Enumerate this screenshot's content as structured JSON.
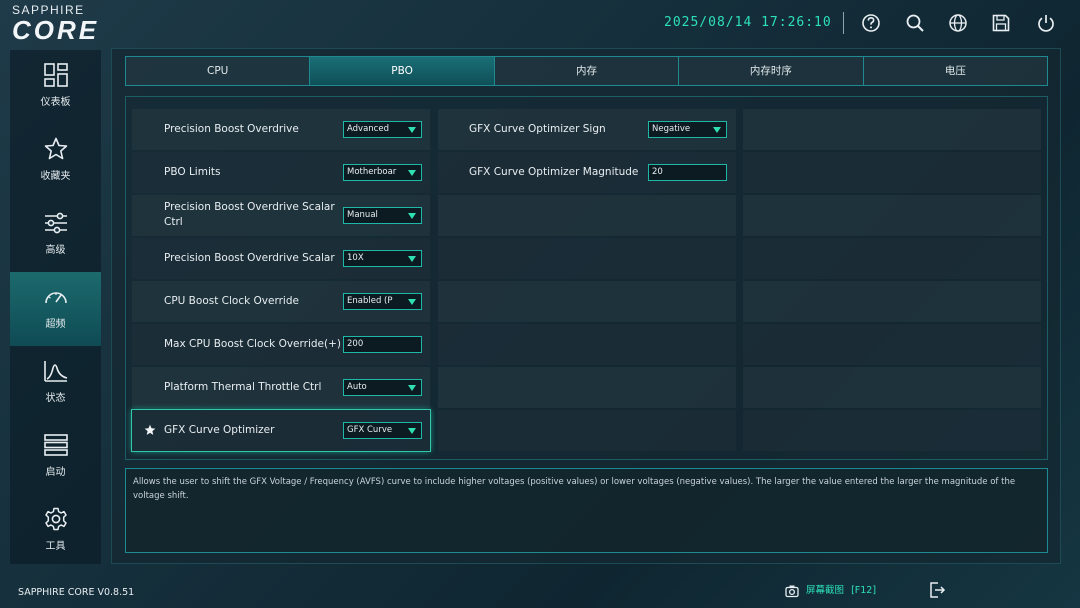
{
  "header": {
    "brand_top": "SAPPHIRE",
    "brand_main": "CORE",
    "datetime": "2025/08/14 17:26:10",
    "icons": [
      "help-icon",
      "search-icon",
      "globe-icon",
      "save-icon",
      "power-icon"
    ]
  },
  "sidebar": {
    "items": [
      {
        "label": "仪表板",
        "icon": "dashboard-icon",
        "active": false
      },
      {
        "label": "收藏夹",
        "icon": "star-icon",
        "active": false
      },
      {
        "label": "高级",
        "icon": "sliders-icon",
        "active": false
      },
      {
        "label": "超频",
        "icon": "gauge-icon",
        "active": true
      },
      {
        "label": "状态",
        "icon": "chart-icon",
        "active": false
      },
      {
        "label": "启动",
        "icon": "boot-icon",
        "active": false
      },
      {
        "label": "工具",
        "icon": "gear-icon",
        "active": false
      }
    ]
  },
  "tabs": [
    {
      "label": "CPU"
    },
    {
      "label": "PBO",
      "active": true
    },
    {
      "label": "内存"
    },
    {
      "label": "内存时序"
    },
    {
      "label": "电压"
    }
  ],
  "settings": {
    "left": [
      {
        "label": "Precision Boost Overdrive",
        "value": "Advanced",
        "type": "select"
      },
      {
        "label": "PBO Limits",
        "value": "Motherboar",
        "type": "select"
      },
      {
        "label": "Precision Boost Overdrive Scalar Ctrl",
        "value": "Manual",
        "type": "select"
      },
      {
        "label": "Precision Boost Overdrive Scalar",
        "value": "10X",
        "type": "select"
      },
      {
        "label": "CPU Boost Clock Override",
        "value": "Enabled (P",
        "type": "select"
      },
      {
        "label": "Max CPU Boost Clock Override(+)",
        "value": "200",
        "type": "input"
      },
      {
        "label": "Platform Thermal Throttle Ctrl",
        "value": "Auto",
        "type": "select"
      },
      {
        "label": "GFX Curve Optimizer",
        "value": "GFX Curve",
        "type": "select",
        "starred": true,
        "selected": true
      }
    ],
    "middle": [
      {
        "label": "GFX Curve Optimizer Sign",
        "value": "Negative",
        "type": "select"
      },
      {
        "label": "GFX Curve Optimizer Magnitude",
        "value": "20",
        "type": "input"
      }
    ]
  },
  "description": "Allows the user to shift the GFX Voltage / Frequency (AVFS) curve to include higher voltages (positive values) or lower voltages (negative values). The larger the value entered the larger the magnitude of the voltage shift.",
  "footer": {
    "version": "SAPPHIRE CORE V0.8.51",
    "screenshot_label": "屏幕截图",
    "screenshot_key": "[F12]"
  },
  "colors": {
    "accent": "#2de0b9",
    "active_tab": "#1a6e76"
  }
}
